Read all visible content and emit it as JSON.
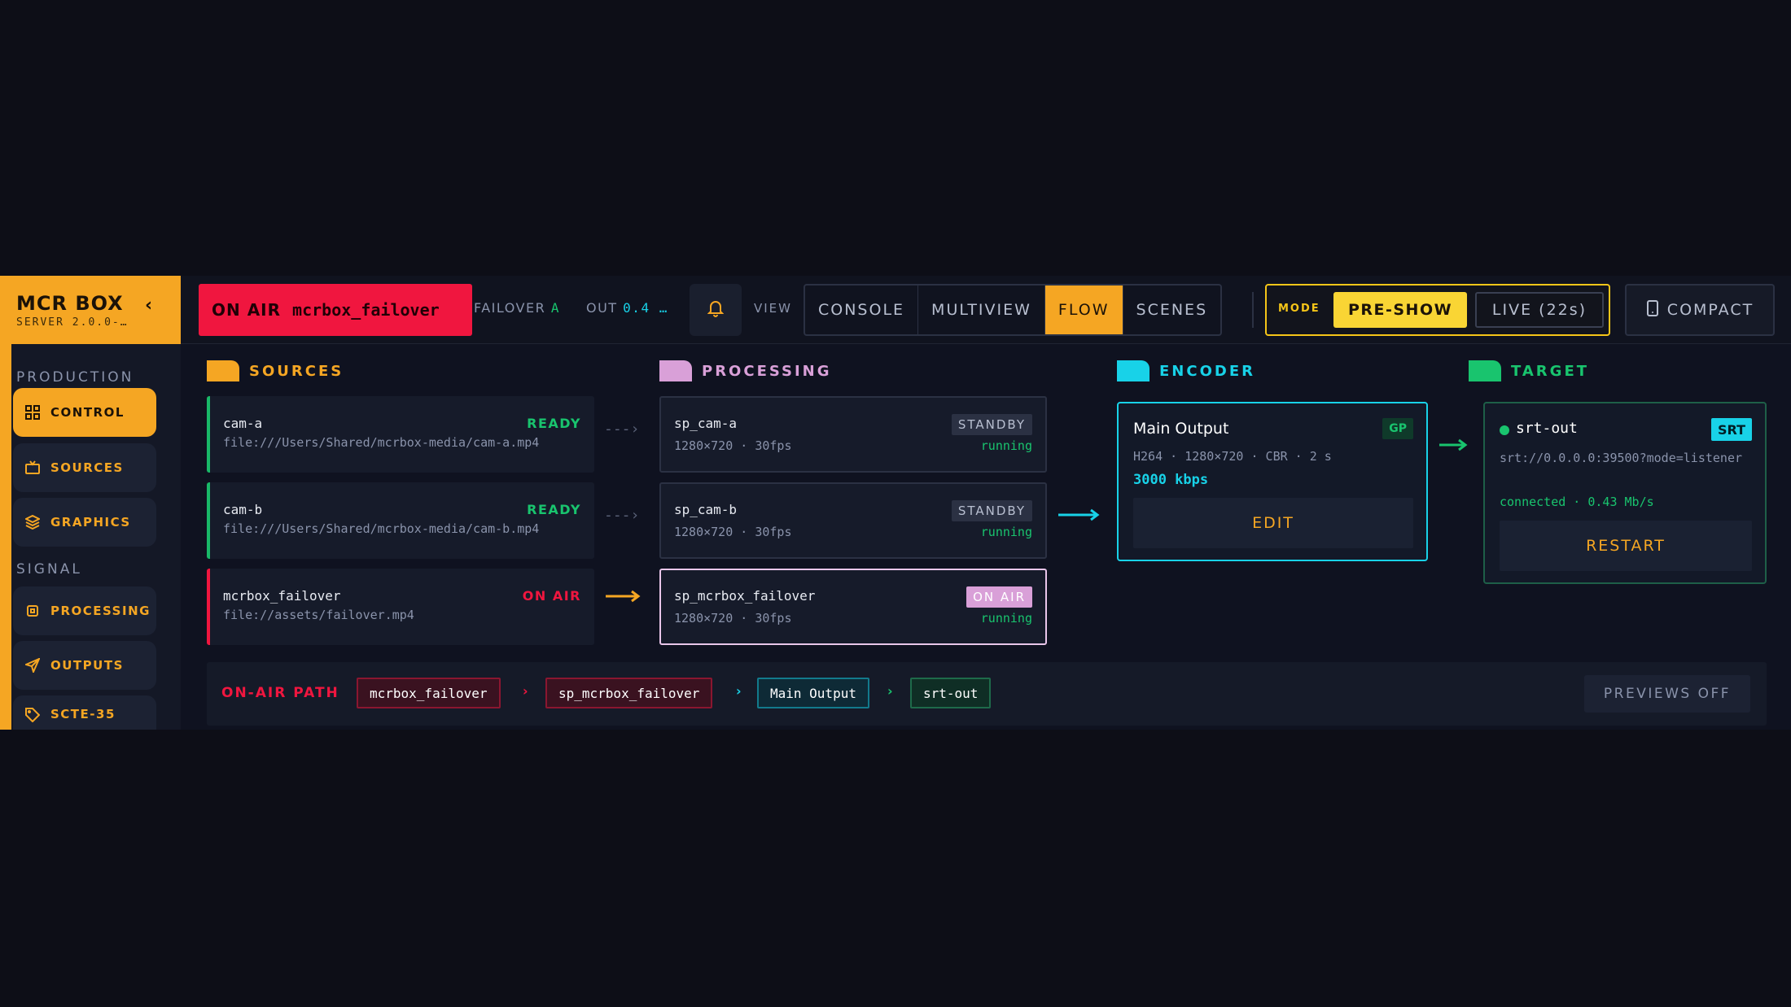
{
  "brand": {
    "title": "MCR BOX",
    "subtitle": "SERVER 2.0.0-…"
  },
  "sidebar": {
    "groups": [
      {
        "label": "PRODUCTION"
      },
      {
        "label": "SIGNAL"
      }
    ],
    "items": [
      {
        "label": "CONTROL",
        "icon": "grid-icon",
        "active": true
      },
      {
        "label": "SOURCES",
        "icon": "tv-icon"
      },
      {
        "label": "GRAPHICS",
        "icon": "layers-icon"
      },
      {
        "label": "PROCESSING",
        "icon": "cpu-icon"
      },
      {
        "label": "OUTPUTS",
        "icon": "send-icon"
      },
      {
        "label": "SCTE-35",
        "icon": "tag-icon"
      }
    ]
  },
  "topbar": {
    "onair_label": "ON AIR",
    "onair_source": "mcrbox_failover",
    "failover_label": "FAILOVER",
    "failover_value": "A",
    "out_label": "OUT",
    "out_value": "0.4 …",
    "view_label": "VIEW",
    "views": [
      "CONSOLE",
      "MULTIVIEW",
      "FLOW",
      "SCENES"
    ],
    "active_view": "FLOW",
    "mode_label": "MODE",
    "mode_preshow": "PRE-SHOW",
    "mode_live": "LIVE (22s)",
    "compact_label": "COMPACT"
  },
  "columns": {
    "sources": "SOURCES",
    "processing": "PROCESSING",
    "encoder": "ENCODER",
    "target": "TARGET"
  },
  "sources": [
    {
      "name": "cam-a",
      "path": "file:///Users/Shared/mcrbox-media/cam-a.mp4",
      "status": "READY"
    },
    {
      "name": "cam-b",
      "path": "file:///Users/Shared/mcrbox-media/cam-b.mp4",
      "status": "READY"
    },
    {
      "name": "mcrbox_failover",
      "path": "file://assets/failover.mp4",
      "status": "ON AIR"
    }
  ],
  "processing": [
    {
      "name": "sp_cam-a",
      "res": "1280×720 · 30fps",
      "badge": "STANDBY",
      "state": "running"
    },
    {
      "name": "sp_cam-b",
      "res": "1280×720 · 30fps",
      "badge": "STANDBY",
      "state": "running"
    },
    {
      "name": "sp_mcrbox_failover",
      "res": "1280×720 · 30fps",
      "badge": "ON AIR",
      "state": "running"
    }
  ],
  "encoder": {
    "name": "Main Output",
    "badge": "GP",
    "spec": "H264 · 1280×720 · CBR · 2 s",
    "bitrate": "3000 kbps",
    "edit_label": "EDIT"
  },
  "target": {
    "name": "srt-out",
    "badge": "SRT",
    "url": "srt://0.0.0.0:39500?mode=listener",
    "status": "connected · 0.43 Mb/s",
    "restart_label": "RESTART"
  },
  "onair_path": {
    "label": "ON-AIR PATH",
    "chain": [
      "mcrbox_failover",
      "sp_mcrbox_failover",
      "Main Output",
      "srt-out"
    ],
    "previews_label": "PREVIEWS OFF"
  },
  "colors": {
    "accent": "#f5a623",
    "onair": "#f0163f",
    "encoder": "#18d2e8",
    "target": "#19c46e",
    "processing": "#d9a0d8"
  }
}
